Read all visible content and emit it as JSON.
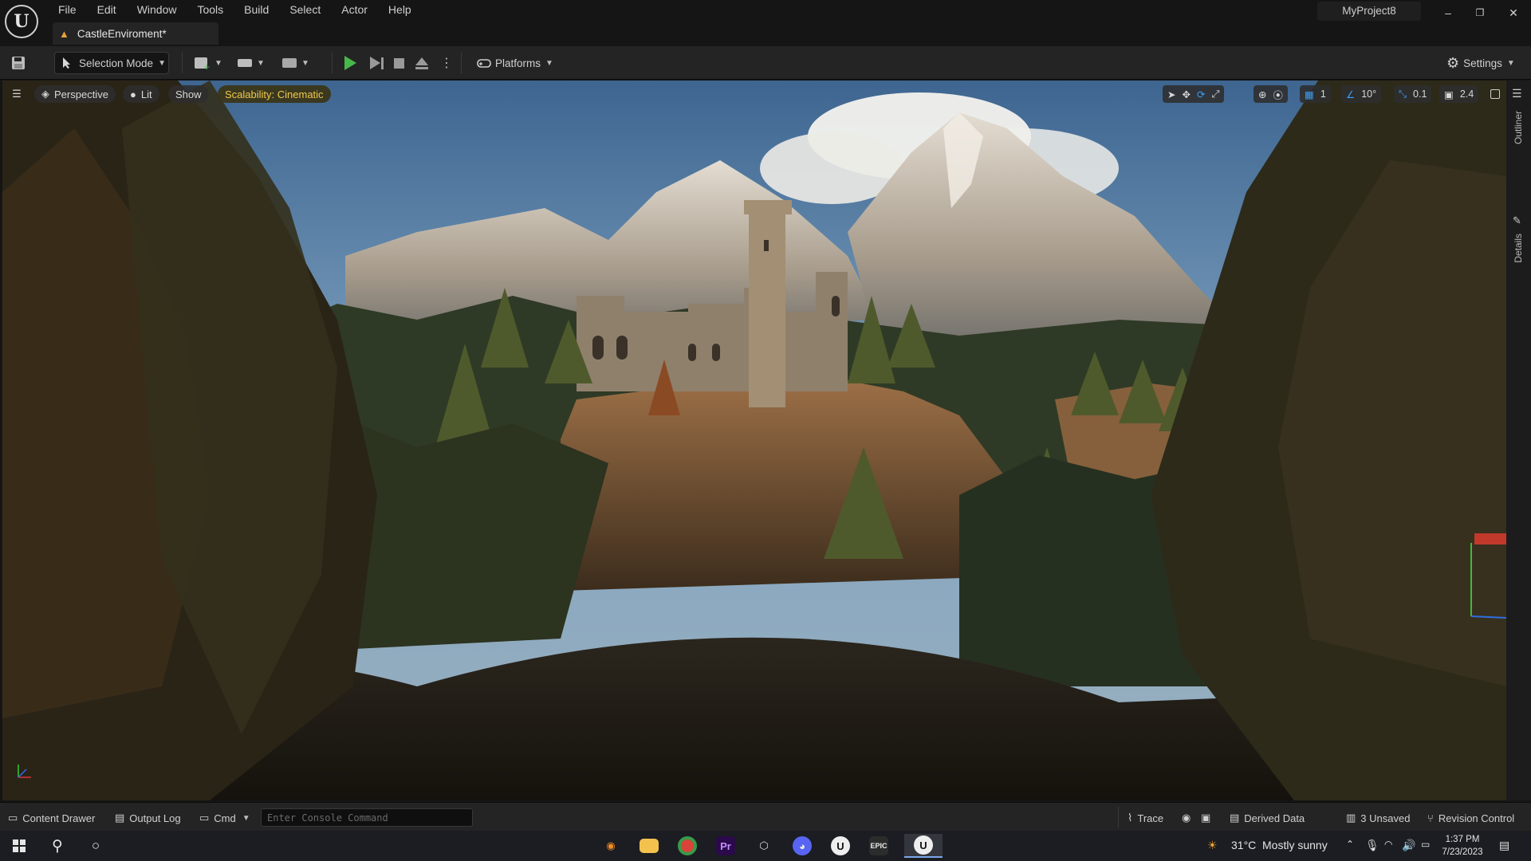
{
  "menu": [
    "File",
    "Edit",
    "Window",
    "Tools",
    "Build",
    "Select",
    "Actor",
    "Help"
  ],
  "document_tab": "CastleEnviroment*",
  "project_name": "MyProject8",
  "window_controls": {
    "minimize": "–",
    "restore": "❐",
    "close": "✕"
  },
  "toolbar": {
    "selection_mode": "Selection Mode",
    "platforms": "Platforms",
    "settings": "Settings"
  },
  "viewport": {
    "view_mode": "Perspective",
    "lighting": "Lit",
    "show": "Show",
    "scalability": "Scalability: Cinematic",
    "grid_snap": "1",
    "rotation_snap": "10°",
    "scale_snap": "0.1",
    "camera_speed": "2.4"
  },
  "side_tabs": {
    "outliner": "Outliner",
    "details": "Details"
  },
  "statusbar": {
    "content_drawer": "Content Drawer",
    "output_log": "Output Log",
    "cmd": "Cmd",
    "console_placeholder": "Enter Console Command",
    "trace": "Trace",
    "derived_data": "Derived Data",
    "unsaved": "3 Unsaved",
    "revision_control": "Revision Control"
  },
  "taskbar": {
    "weather_temp": "31°C",
    "weather_desc": "Mostly sunny",
    "time": "1:37 PM",
    "date": "7/23/2023"
  },
  "colors": {
    "accent_play": "#47b84a",
    "scalability_text": "#f0c84a",
    "snap_blue": "#3d9bf0"
  }
}
